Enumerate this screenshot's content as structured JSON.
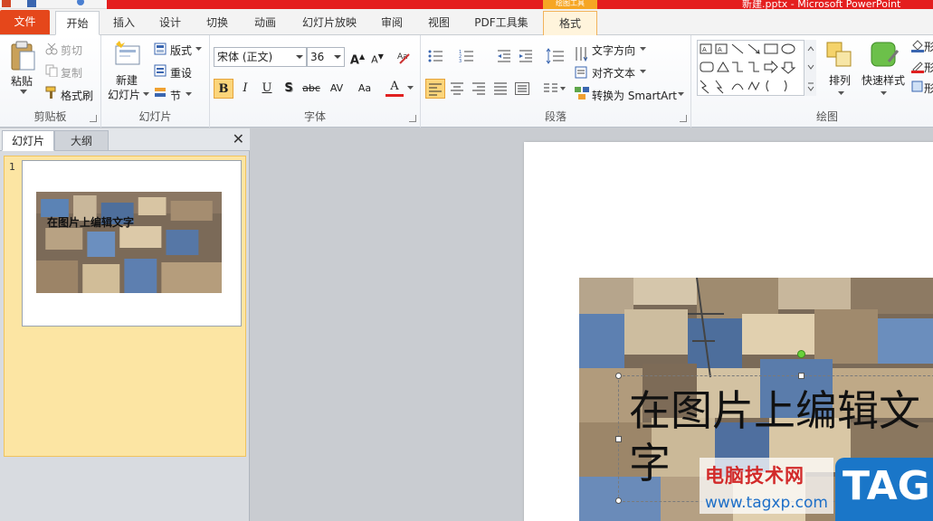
{
  "title_bar": {
    "doc_title": "新建.pptx - Microsoft PowerPoint",
    "context_label": "绘图工具"
  },
  "tabs": [
    {
      "label": "文件"
    },
    {
      "label": "开始"
    },
    {
      "label": "插入"
    },
    {
      "label": "设计"
    },
    {
      "label": "切换"
    },
    {
      "label": "动画"
    },
    {
      "label": "幻灯片放映"
    },
    {
      "label": "审阅"
    },
    {
      "label": "视图"
    },
    {
      "label": "PDF工具集"
    },
    {
      "label": "格式"
    }
  ],
  "ribbon": {
    "clipboard": {
      "group_label": "剪贴板",
      "paste": "粘贴",
      "cut": "剪切",
      "copy": "复制",
      "format_painter": "格式刷"
    },
    "slides": {
      "group_label": "幻灯片",
      "new_slide_line1": "新建",
      "new_slide_line2": "幻灯片",
      "layout": "版式",
      "reset": "重设",
      "section": "节"
    },
    "font": {
      "group_label": "字体",
      "font_name": "宋体 (正文)",
      "font_size": "36",
      "bold": "B",
      "italic": "I",
      "underline": "U",
      "shadow": "S",
      "strike": "abc",
      "spacing": "AV",
      "case": "Aa",
      "color": "A",
      "grow": "A",
      "shrink": "A"
    },
    "paragraph": {
      "group_label": "段落",
      "text_direction": "文字方向",
      "align_text": "对齐文本",
      "convert_smartart": "转换为 SmartArt"
    },
    "drawing": {
      "group_label": "绘图",
      "arrange": "排列",
      "quick_styles": "快速样式",
      "shape_fill": "形",
      "shape_outline": "形",
      "shape_effects": "形"
    }
  },
  "left_panel": {
    "tab_slides": "幻灯片",
    "tab_outline": "大纲",
    "close": "✕",
    "slide_number": "1",
    "thumb_text": "在图片上编辑文字"
  },
  "slide": {
    "text": "在图片上编辑文\n字"
  },
  "watermark": {
    "title": "电脑技术网",
    "url": "www.tagxp.com",
    "tag": "TAG"
  },
  "colors": {
    "file_tab": "#e5471b",
    "title_red": "#e41e1e",
    "selection_fill": "#fbd57a",
    "watermark_blue": "#1a76c8"
  }
}
